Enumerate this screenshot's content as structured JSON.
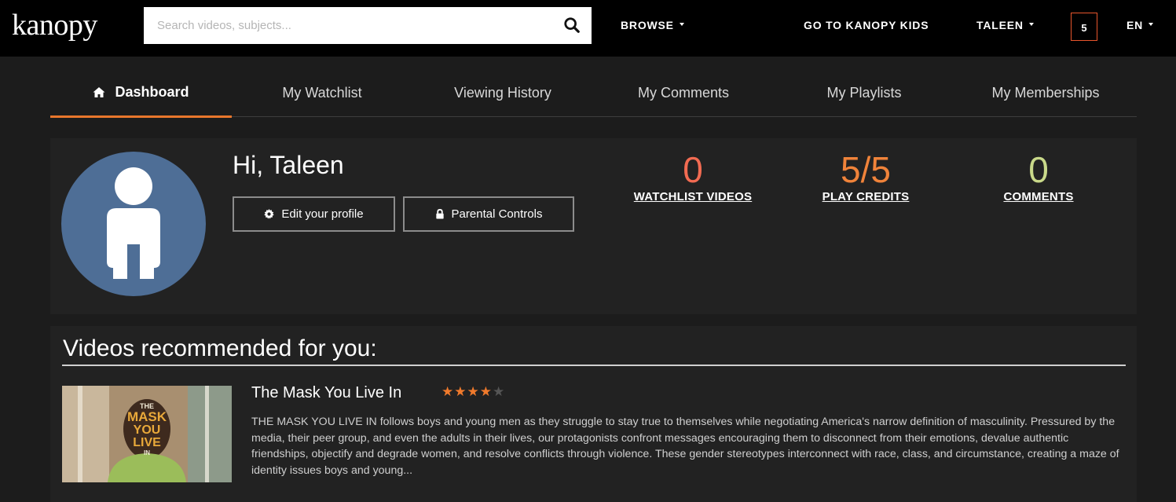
{
  "header": {
    "logo": "kanopy",
    "search_placeholder": "Search videos, subjects...",
    "browse_label": "BROWSE",
    "kids_label": "GO TO KANOPY KIDS",
    "user_label": "TALEEN",
    "credits_badge": "5",
    "language_label": "EN"
  },
  "tabs": [
    {
      "label": "Dashboard",
      "active": true
    },
    {
      "label": "My Watchlist"
    },
    {
      "label": "Viewing History"
    },
    {
      "label": "My Comments"
    },
    {
      "label": "My Playlists"
    },
    {
      "label": "My Memberships"
    }
  ],
  "profile": {
    "greeting": "Hi, Taleen",
    "edit_label": "Edit your profile",
    "parental_label": "Parental Controls"
  },
  "stats": [
    {
      "value": "0",
      "label": "WATCHLIST VIDEOS",
      "color": "#f26b52"
    },
    {
      "value": "5/5",
      "label": "PLAY CREDITS",
      "color": "#f0833a"
    },
    {
      "value": "0",
      "label": "COMMENTS",
      "color": "#c9d98a"
    }
  ],
  "recommendations": {
    "heading": "Videos recommended for you:",
    "items": [
      {
        "title": "The Mask You Live In",
        "rating": 4,
        "rating_max": 5,
        "thumb_text": [
          "THE",
          "MASK",
          "YOU",
          "LIVE",
          "IN"
        ],
        "description": "THE MASK YOU LIVE IN follows boys and young men as they struggle to stay true to themselves while negotiating America's narrow definition of masculinity. Pressured by the media, their peer group, and even the adults in their lives, our protagonists confront messages encouraging them to disconnect from their emotions, devalue authentic friendships, objectify and degrade women, and resolve conflicts through violence. These gender stereotypes interconnect with race, class, and circumstance, creating a maze of identity issues boys and young..."
      }
    ]
  },
  "colors": {
    "accent": "#e8762c",
    "avatar": "#4e6e96",
    "star_on": "#f07a2c"
  }
}
